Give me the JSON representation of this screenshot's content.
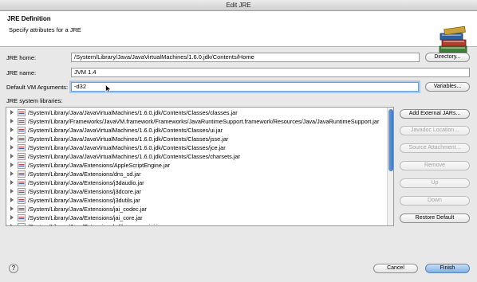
{
  "window": {
    "title": "Edit JRE"
  },
  "header": {
    "title": "JRE Definition",
    "subtitle": "Specify attributes for a JRE",
    "icon": "books-icon"
  },
  "form": {
    "jre_home_label": "JRE home:",
    "jre_home_value": "/System/Library/Java/JavaVirtualMachines/1.6.0.jdk/Contents/Home",
    "directory_button": "Directory...",
    "jre_name_label": "JRE name:",
    "jre_name_value": "JVM 1.4",
    "vm_args_label": "Default VM Arguments:",
    "vm_args_value": "-d32",
    "variables_button": "Variables..."
  },
  "libraries": {
    "label": "JRE system libraries:",
    "items": [
      "/System/Library/Java/JavaVirtualMachines/1.6.0.jdk/Contents/Classes/classes.jar",
      "/System/Library/Frameworks/JavaVM.framework/Frameworks/JavaRuntimeSupport.framework/Resources/Java/JavaRuntimeSupport.jar",
      "/System/Library/Java/JavaVirtualMachines/1.6.0.jdk/Contents/Classes/ui.jar",
      "/System/Library/Java/JavaVirtualMachines/1.6.0.jdk/Contents/Classes/jsse.jar",
      "/System/Library/Java/JavaVirtualMachines/1.6.0.jdk/Contents/Classes/jce.jar",
      "/System/Library/Java/JavaVirtualMachines/1.6.0.jdk/Contents/Classes/charsets.jar",
      "/System/Library/Java/Extensions/AppleScriptEngine.jar",
      "/System/Library/Java/Extensions/dns_sd.jar",
      "/System/Library/Java/Extensions/j3daudio.jar",
      "/System/Library/Java/Extensions/j3dcore.jar",
      "/System/Library/Java/Extensions/j3dutils.jar",
      "/System/Library/Java/Extensions/jai_codec.jar",
      "/System/Library/Java/Extensions/jai_core.jar",
      "/System/Library/Java/Extensions/mlibwrapper_jai.jar"
    ],
    "buttons": {
      "add_external": "Add External JARs...",
      "javadoc": "Javadoc Location...",
      "source": "Source Attachment...",
      "remove": "Remove",
      "up": "Up",
      "down": "Down",
      "restore": "Restore Default"
    }
  },
  "footer": {
    "help": "?",
    "cancel": "Cancel",
    "finish": "Finish"
  }
}
